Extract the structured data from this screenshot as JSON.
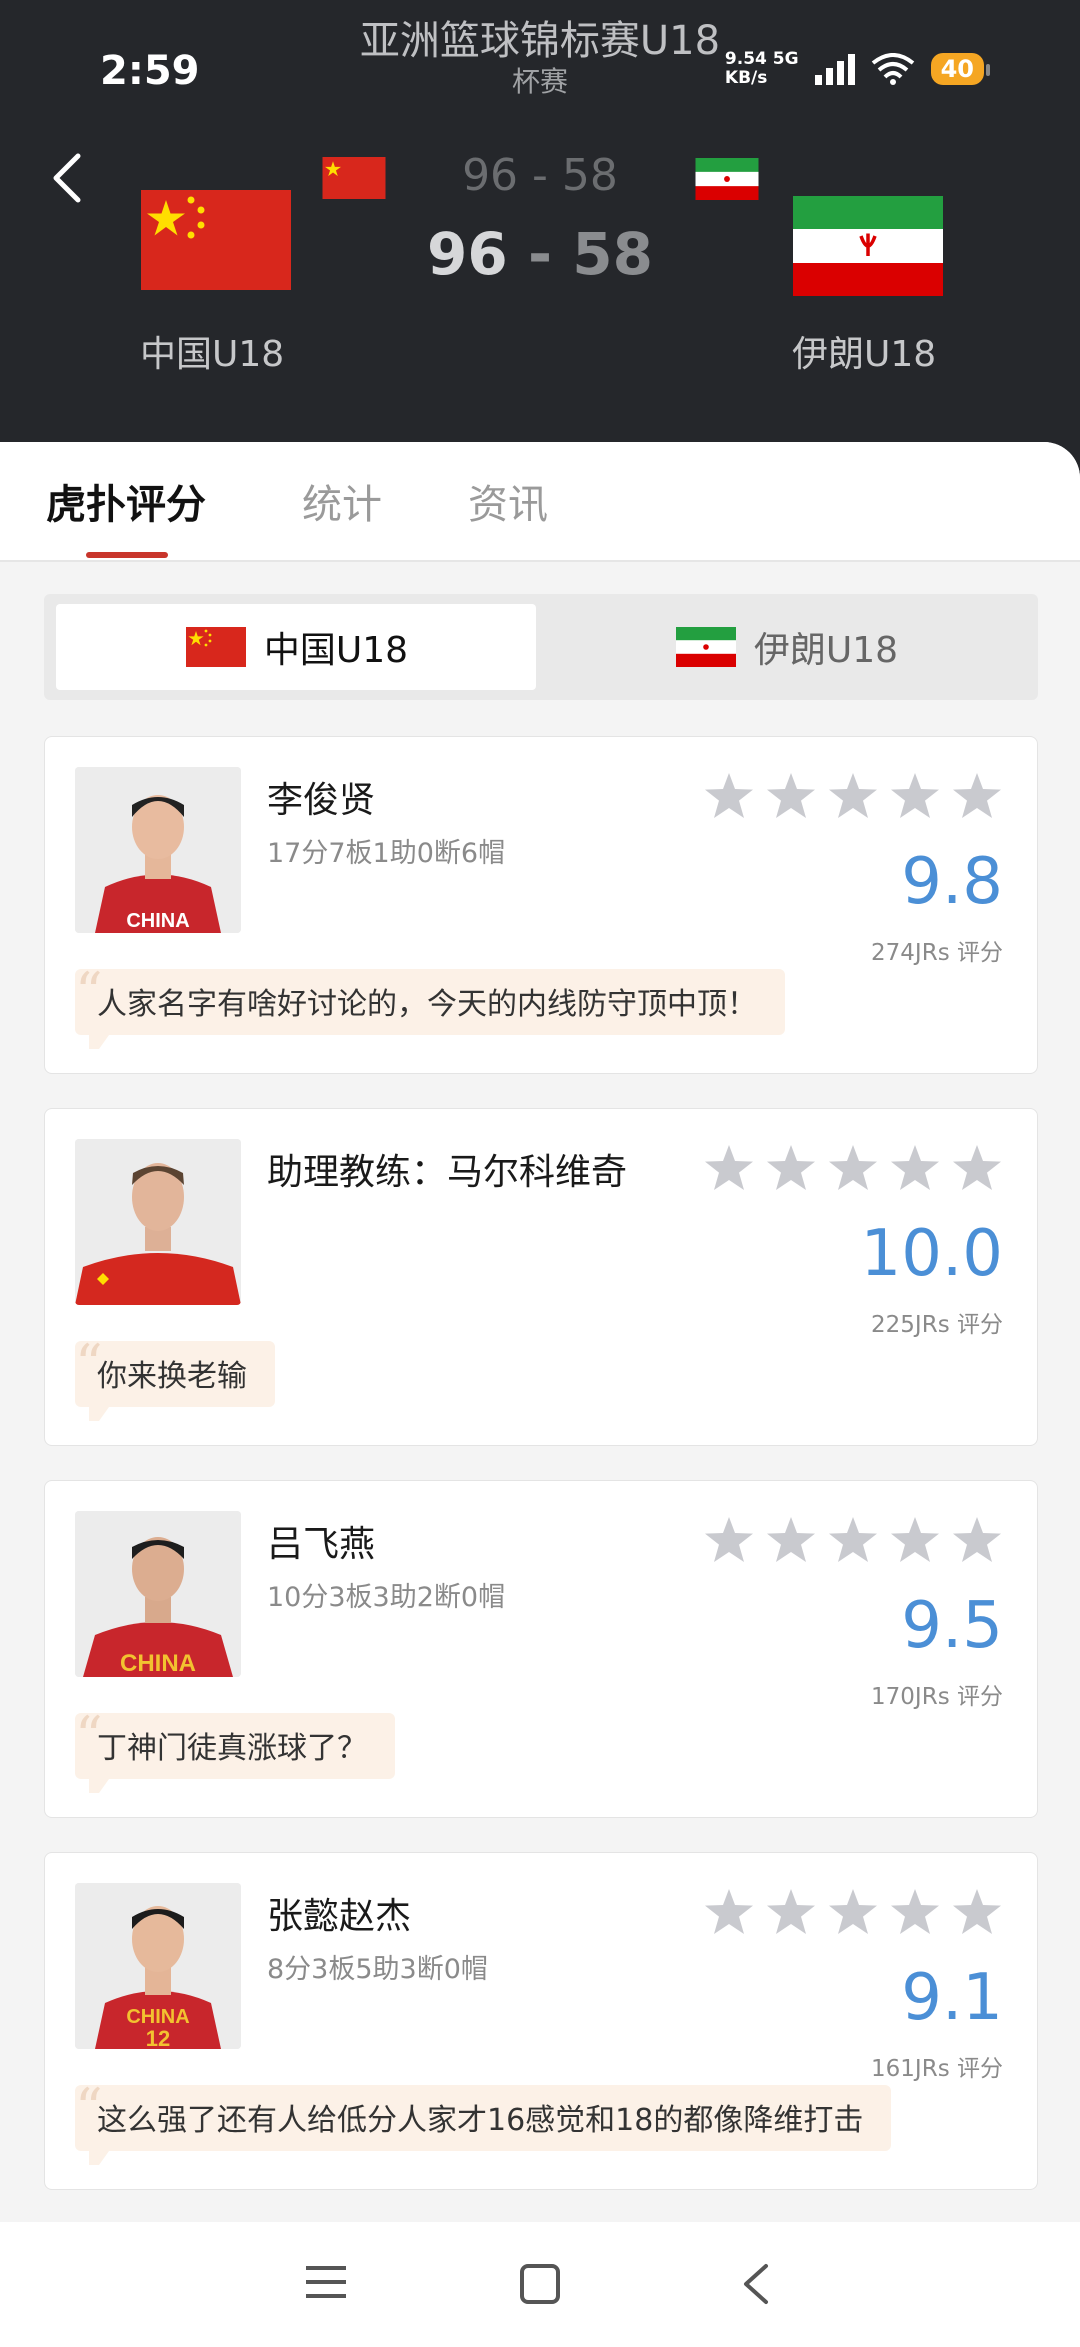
{
  "status_bar": {
    "time": "2:59",
    "net_speed_value": "9.54",
    "net_speed_unit": "KB/s",
    "network": "5G",
    "battery": "40"
  },
  "header": {
    "title": "亚洲篮球锦标赛U18",
    "subtitle": "杯赛",
    "score_small_home": "96",
    "score_small_away": "58",
    "score_big_home": "96",
    "score_big_away": "58",
    "score_separator": " - ",
    "home_team": "中国U18",
    "away_team": "伊朗U18"
  },
  "tabs": [
    {
      "label": "虎扑评分",
      "active": true
    },
    {
      "label": "统计",
      "active": false
    },
    {
      "label": "资讯",
      "active": false
    }
  ],
  "team_switch": {
    "home": "中国U18",
    "away": "伊朗U18",
    "selected": "home"
  },
  "players": [
    {
      "name": "李俊贤",
      "stats": "17分7板1助0断6帽",
      "rating": "9.8",
      "votes": "274JRs 评分",
      "comment": "人家名字有啥好讨论的，今天的内线防守顶中顶！",
      "jersey_text": "CHINA"
    },
    {
      "name": "助理教练：马尔科维奇",
      "stats": "",
      "rating": "10.0",
      "votes": "225JRs 评分",
      "comment": "你来换老输",
      "jersey_text": ""
    },
    {
      "name": "吕飞燕",
      "stats": "10分3板3助2断0帽",
      "rating": "9.5",
      "votes": "170JRs 评分",
      "comment": "丁神门徒真涨球了？",
      "jersey_text": "CHINA"
    },
    {
      "name": "张懿赵杰",
      "stats": "8分3板5助3断0帽",
      "rating": "9.1",
      "votes": "161JRs 评分",
      "comment": "这么强了还有人给低分人家才16感觉和18的都像降维打击",
      "jersey_text": "CHINA",
      "jersey_number": "12"
    }
  ],
  "colors": {
    "header_bg": "#25272b",
    "accent_red": "#c8352b",
    "rating_blue": "#4b8fd6",
    "star_gray": "#c9cacf",
    "comment_bg": "#fcf1e7",
    "battery": "#f5a623"
  },
  "icons": {
    "back": "chevron-left-icon",
    "star": "star-icon",
    "menu": "menu-icon",
    "home": "square-home-icon",
    "nav_back": "triangle-back-icon"
  }
}
